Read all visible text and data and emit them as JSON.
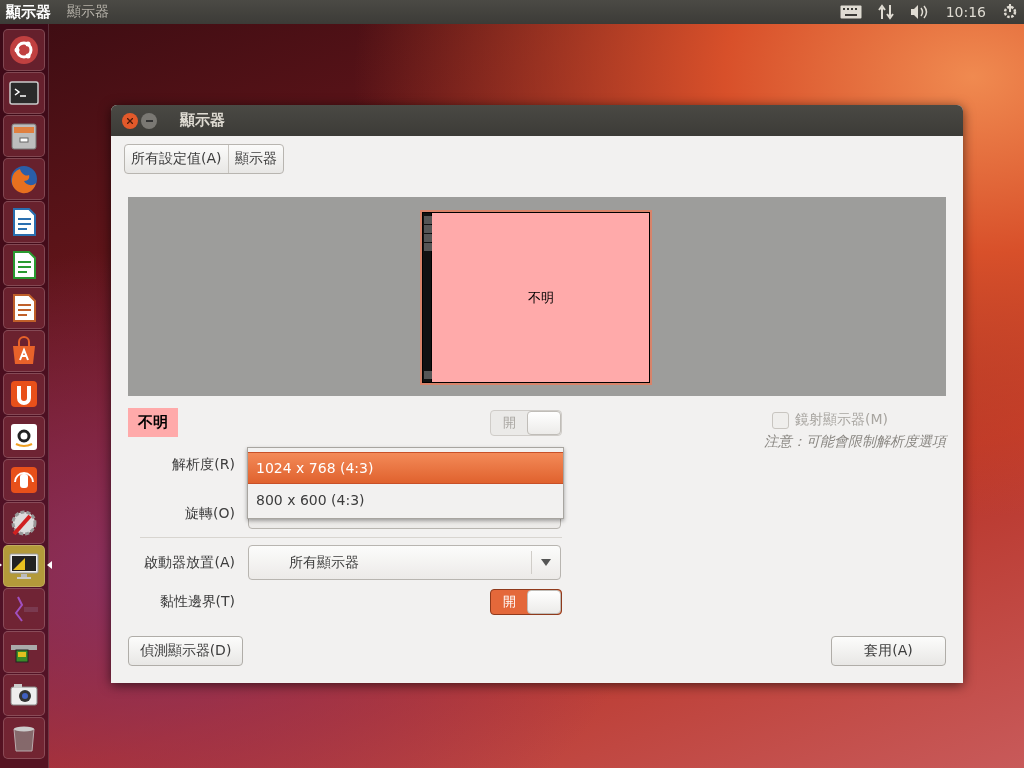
{
  "top_panel": {
    "app_name": "顯示器",
    "menu": "顯示器",
    "clock": "10:16"
  },
  "launcher": [
    {
      "kind": "ubuntu",
      "active": false
    },
    {
      "kind": "terminal",
      "active": false
    },
    {
      "kind": "files",
      "active": false
    },
    {
      "kind": "browser",
      "active": false
    },
    {
      "kind": "writer",
      "active": false
    },
    {
      "kind": "calc",
      "active": false
    },
    {
      "kind": "impress",
      "active": false
    },
    {
      "kind": "software",
      "active": false
    },
    {
      "kind": "cloud",
      "active": false
    },
    {
      "kind": "shop",
      "active": false
    },
    {
      "kind": "music",
      "active": false
    },
    {
      "kind": "settings",
      "active": false
    },
    {
      "kind": "display",
      "active": true
    },
    {
      "kind": "graph",
      "active": false
    },
    {
      "kind": "hardware",
      "active": false
    },
    {
      "kind": "camera",
      "active": false
    },
    {
      "kind": "trash",
      "active": false
    }
  ],
  "window": {
    "title": "顯示器",
    "breadcrumb": [
      {
        "label": "所有設定值(A)"
      },
      {
        "label": "顯示器"
      }
    ],
    "preview": {
      "monitor_label": "不明"
    },
    "monitor": {
      "name": "不明",
      "power_switch": {
        "label": "開",
        "on": true,
        "disabled": true
      },
      "mirror": {
        "label": "鏡射顯示器(M)",
        "checked": false,
        "disabled": true
      },
      "note": "注意：可能會限制解析度選項"
    },
    "resolution": {
      "label": "解析度(R)",
      "options": [
        {
          "label": "1024 x 768 (4:3)",
          "selected": true
        },
        {
          "label": "800 x 600 (4:3)",
          "selected": false
        }
      ]
    },
    "rotation": {
      "label": "旋轉(O)"
    },
    "launcher_placement": {
      "label": "啟動器放置(A)",
      "value": "所有顯示器"
    },
    "sticky_edges": {
      "label": "黏性邊界(T)",
      "switch": {
        "label": "開",
        "on": true,
        "disabled": false
      }
    },
    "buttons": [
      {
        "label": "偵測顯示器(D)"
      },
      {
        "label": "套用(A)"
      }
    ]
  }
}
